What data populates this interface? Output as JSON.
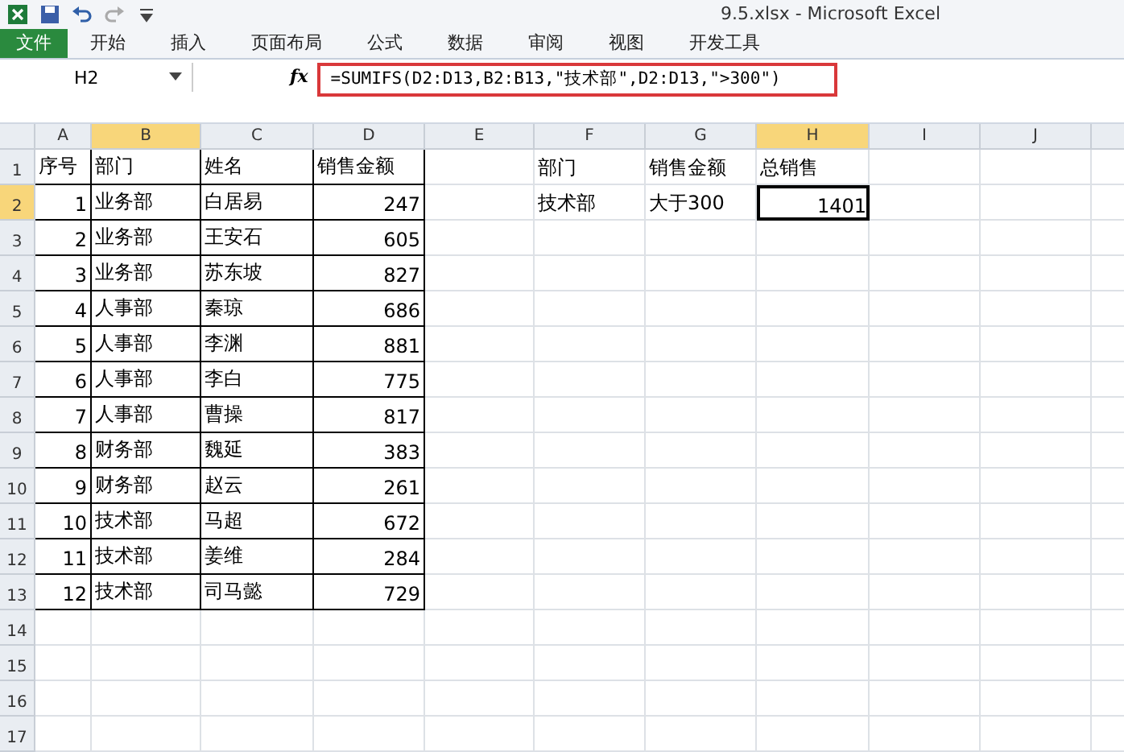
{
  "window": {
    "title": "9.5.xlsx  -  Microsoft Excel"
  },
  "ribbon_tabs": [
    {
      "label": "文件",
      "kind": "file"
    },
    {
      "label": "开始",
      "kind": "tab"
    },
    {
      "label": "插入",
      "kind": "tab"
    },
    {
      "label": "页面布局",
      "kind": "tab"
    },
    {
      "label": "公式",
      "kind": "tab"
    },
    {
      "label": "数据",
      "kind": "tab"
    },
    {
      "label": "审阅",
      "kind": "tab"
    },
    {
      "label": "视图",
      "kind": "tab"
    },
    {
      "label": "开发工具",
      "kind": "tab"
    }
  ],
  "name_box": "H2",
  "function_button": "fx",
  "formula": "=SUMIFS(D2:D13,B2:B13,\"技术部\",D2:D13,\">300\")",
  "columns": [
    {
      "label": "A",
      "selected": false
    },
    {
      "label": "B",
      "selected": true
    },
    {
      "label": "C",
      "selected": false
    },
    {
      "label": "D",
      "selected": false
    },
    {
      "label": "E",
      "selected": false
    },
    {
      "label": "F",
      "selected": false
    },
    {
      "label": "G",
      "selected": false
    },
    {
      "label": "H",
      "selected": true
    },
    {
      "label": "I",
      "selected": false
    },
    {
      "label": "J",
      "selected": false
    }
  ],
  "rows": [
    {
      "label": "1",
      "selected": false,
      "cells": {
        "A": {
          "text": "序号",
          "kind": "text"
        },
        "B": {
          "text": "部门",
          "kind": "text"
        },
        "C": {
          "text": "姓名",
          "kind": "text"
        },
        "D": {
          "text": "销售金额",
          "kind": "text"
        },
        "F": {
          "text": "部门",
          "kind": "text"
        },
        "G": {
          "text": "销售金额",
          "kind": "text"
        },
        "H": {
          "text": "总销售",
          "kind": "text"
        }
      }
    },
    {
      "label": "2",
      "selected": true,
      "cells": {
        "A": {
          "text": "1",
          "kind": "number"
        },
        "B": {
          "text": "业务部",
          "kind": "text"
        },
        "C": {
          "text": "白居易",
          "kind": "text"
        },
        "D": {
          "text": "247",
          "kind": "number"
        },
        "F": {
          "text": "技术部",
          "kind": "text"
        },
        "G": {
          "text": "大于300",
          "kind": "text"
        },
        "H": {
          "text": "1401",
          "kind": "number",
          "active": true
        }
      }
    },
    {
      "label": "3",
      "selected": false,
      "cells": {
        "A": {
          "text": "2",
          "kind": "number"
        },
        "B": {
          "text": "业务部",
          "kind": "text"
        },
        "C": {
          "text": "王安石",
          "kind": "text"
        },
        "D": {
          "text": "605",
          "kind": "number"
        }
      }
    },
    {
      "label": "4",
      "selected": false,
      "cells": {
        "A": {
          "text": "3",
          "kind": "number"
        },
        "B": {
          "text": "业务部",
          "kind": "text"
        },
        "C": {
          "text": "苏东坡",
          "kind": "text"
        },
        "D": {
          "text": "827",
          "kind": "number"
        }
      }
    },
    {
      "label": "5",
      "selected": false,
      "cells": {
        "A": {
          "text": "4",
          "kind": "number"
        },
        "B": {
          "text": "人事部",
          "kind": "text"
        },
        "C": {
          "text": "秦琼",
          "kind": "text"
        },
        "D": {
          "text": "686",
          "kind": "number"
        }
      }
    },
    {
      "label": "6",
      "selected": false,
      "cells": {
        "A": {
          "text": "5",
          "kind": "number"
        },
        "B": {
          "text": "人事部",
          "kind": "text"
        },
        "C": {
          "text": "李渊",
          "kind": "text"
        },
        "D": {
          "text": "881",
          "kind": "number"
        }
      }
    },
    {
      "label": "7",
      "selected": false,
      "cells": {
        "A": {
          "text": "6",
          "kind": "number"
        },
        "B": {
          "text": "人事部",
          "kind": "text"
        },
        "C": {
          "text": "李白",
          "kind": "text"
        },
        "D": {
          "text": "775",
          "kind": "number"
        }
      }
    },
    {
      "label": "8",
      "selected": false,
      "cells": {
        "A": {
          "text": "7",
          "kind": "number"
        },
        "B": {
          "text": "人事部",
          "kind": "text"
        },
        "C": {
          "text": "曹操",
          "kind": "text"
        },
        "D": {
          "text": "817",
          "kind": "number"
        }
      }
    },
    {
      "label": "9",
      "selected": false,
      "cells": {
        "A": {
          "text": "8",
          "kind": "number"
        },
        "B": {
          "text": "财务部",
          "kind": "text"
        },
        "C": {
          "text": "魏延",
          "kind": "text"
        },
        "D": {
          "text": "383",
          "kind": "number"
        }
      }
    },
    {
      "label": "10",
      "selected": false,
      "cells": {
        "A": {
          "text": "9",
          "kind": "number"
        },
        "B": {
          "text": "财务部",
          "kind": "text"
        },
        "C": {
          "text": "赵云",
          "kind": "text"
        },
        "D": {
          "text": "261",
          "kind": "number"
        }
      }
    },
    {
      "label": "11",
      "selected": false,
      "cells": {
        "A": {
          "text": "10",
          "kind": "number"
        },
        "B": {
          "text": "技术部",
          "kind": "text"
        },
        "C": {
          "text": "马超",
          "kind": "text"
        },
        "D": {
          "text": "672",
          "kind": "number"
        }
      }
    },
    {
      "label": "12",
      "selected": false,
      "cells": {
        "A": {
          "text": "11",
          "kind": "number"
        },
        "B": {
          "text": "技术部",
          "kind": "text"
        },
        "C": {
          "text": "姜维",
          "kind": "text"
        },
        "D": {
          "text": "284",
          "kind": "number"
        }
      }
    },
    {
      "label": "13",
      "selected": false,
      "cells": {
        "A": {
          "text": "12",
          "kind": "number"
        },
        "B": {
          "text": "技术部",
          "kind": "text"
        },
        "C": {
          "text": "司马懿",
          "kind": "text"
        },
        "D": {
          "text": "729",
          "kind": "number"
        }
      }
    },
    {
      "label": "14",
      "selected": false
    },
    {
      "label": "15",
      "selected": false
    },
    {
      "label": "16",
      "selected": false
    },
    {
      "label": "17",
      "selected": false
    }
  ]
}
